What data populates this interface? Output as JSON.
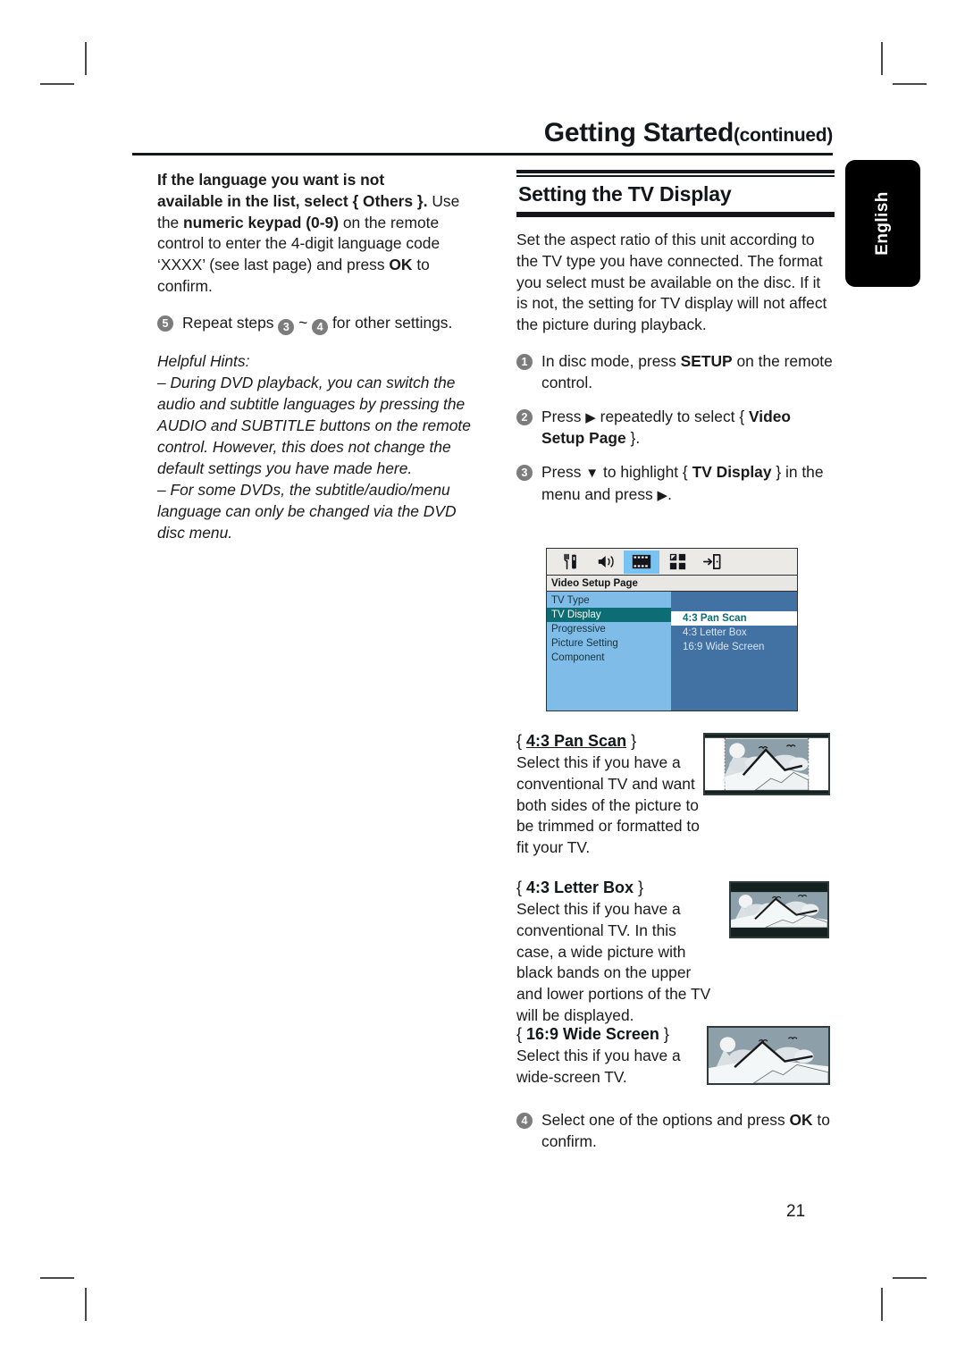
{
  "masthead": {
    "title": "Getting Started",
    "continued": "(continued)"
  },
  "language_tab": {
    "label": "English"
  },
  "page_number": "21",
  "left_column": {
    "note_bold_line1": "If the language you want is not",
    "note_bold_line2": "available in the list, select { Others }.",
    "note_rest": "Use the ",
    "note_bold_kw": "numeric keypad (0-9)",
    "note_rest2": " on the remote control to enter the 4-digit language code ‘XXXX’ (see last page) and press ",
    "note_bold_ok": "OK",
    "note_rest3": " to confirm.",
    "step5_num": "5",
    "step5_text_a": "Repeat steps ",
    "step5_n1": "3",
    "step5_tilde": " ~ ",
    "step5_n2": "4",
    "step5_text_b": " for other settings.",
    "hints_title": "Helpful Hints:",
    "hint1": "– During DVD playback, you can switch the audio and subtitle languages by pressing the AUDIO and SUBTITLE buttons on the remote control. However, this does not change the default settings you have made here.",
    "hint2": "– For some DVDs, the subtitle/audio/menu language can only be changed via the DVD disc menu."
  },
  "right_column": {
    "section_title": "Setting the TV Display",
    "intro": "Set the aspect ratio of this unit according to the TV type you have connected. The format you select must be available on the disc. If it is not, the setting for TV display will not affect the picture during playback.",
    "steps": [
      {
        "num": "1",
        "parts": [
          {
            "t": "In disc mode, press ",
            "b": false
          },
          {
            "t": "SETUP",
            "b": true
          },
          {
            "t": " on the remote control.",
            "b": false
          }
        ]
      },
      {
        "num": "2",
        "parts": [
          {
            "t": "Press ",
            "b": false
          },
          {
            "t": "▶",
            "b": false,
            "icon": "right-arrow"
          },
          {
            "t": " repeatedly to select { ",
            "b": false
          },
          {
            "t": "Video Setup Page",
            "b": true
          },
          {
            "t": " }.",
            "b": false
          }
        ]
      },
      {
        "num": "3",
        "parts": [
          {
            "t": "Press ",
            "b": false
          },
          {
            "t": "▼",
            "b": false,
            "icon": "down-arrow"
          },
          {
            "t": " to highlight { ",
            "b": false
          },
          {
            "t": "TV Display",
            "b": true
          },
          {
            "t": " } in the menu and press ",
            "b": false
          },
          {
            "t": "▶",
            "b": false,
            "icon": "right-arrow"
          },
          {
            "t": ".",
            "b": false
          }
        ]
      }
    ],
    "final_step": {
      "num": "4",
      "parts": [
        {
          "t": "Select one of the options and press ",
          "b": false
        },
        {
          "t": "OK",
          "b": true
        },
        {
          "t": " to confirm.",
          "b": false
        }
      ]
    }
  },
  "osd": {
    "page_title": "Video Setup Page",
    "icons": [
      {
        "name": "general-setup-icon",
        "glyph": "utensils",
        "selected": false
      },
      {
        "name": "audio-setup-icon",
        "glyph": "speaker",
        "selected": false
      },
      {
        "name": "video-setup-icon",
        "glyph": "film-strip",
        "selected": true
      },
      {
        "name": "preference-setup-icon",
        "glyph": "grid",
        "selected": false
      },
      {
        "name": "exit-setup-icon",
        "glyph": "exit-door",
        "selected": false
      }
    ],
    "menu_items": [
      {
        "label": "TV Type",
        "highlighted": false
      },
      {
        "label": "TV Display",
        "highlighted": true
      },
      {
        "label": "Progressive",
        "highlighted": false
      },
      {
        "label": "Picture Setting",
        "highlighted": false
      },
      {
        "label": "Component",
        "highlighted": false
      }
    ],
    "options": [
      {
        "label": "4:3 Pan Scan",
        "selected": true
      },
      {
        "label": "4:3 Letter Box",
        "selected": false
      },
      {
        "label": "16:9 Wide Screen",
        "selected": false
      }
    ],
    "colors": {
      "pane_left": "#7fbce8",
      "pane_right": "#4272a4",
      "highlight": "#0c6d75",
      "icon_selected": "#79c3f2"
    }
  },
  "options_explained": [
    {
      "open_brace": "{ ",
      "name": "4:3 Pan Scan",
      "close_brace": " }",
      "underlined": true,
      "body": "Select this if you have a conventional TV and want both sides of the picture to be trimmed or formatted to fit your TV.",
      "thumb": "pan-scan-thumbnail"
    },
    {
      "open_brace": "{ ",
      "name": "4:3 Letter Box",
      "close_brace": " }",
      "underlined": false,
      "body": "Select this if you have a conventional TV. In this case, a wide picture with black bands on the upper and lower portions of the TV will be displayed.",
      "thumb": "letter-box-thumbnail"
    },
    {
      "open_brace": "{ ",
      "name": "16:9 Wide Screen",
      "close_brace": " }",
      "underlined": false,
      "body": "Select this if you have a wide-screen TV.",
      "thumb": "wide-screen-thumbnail"
    }
  ]
}
